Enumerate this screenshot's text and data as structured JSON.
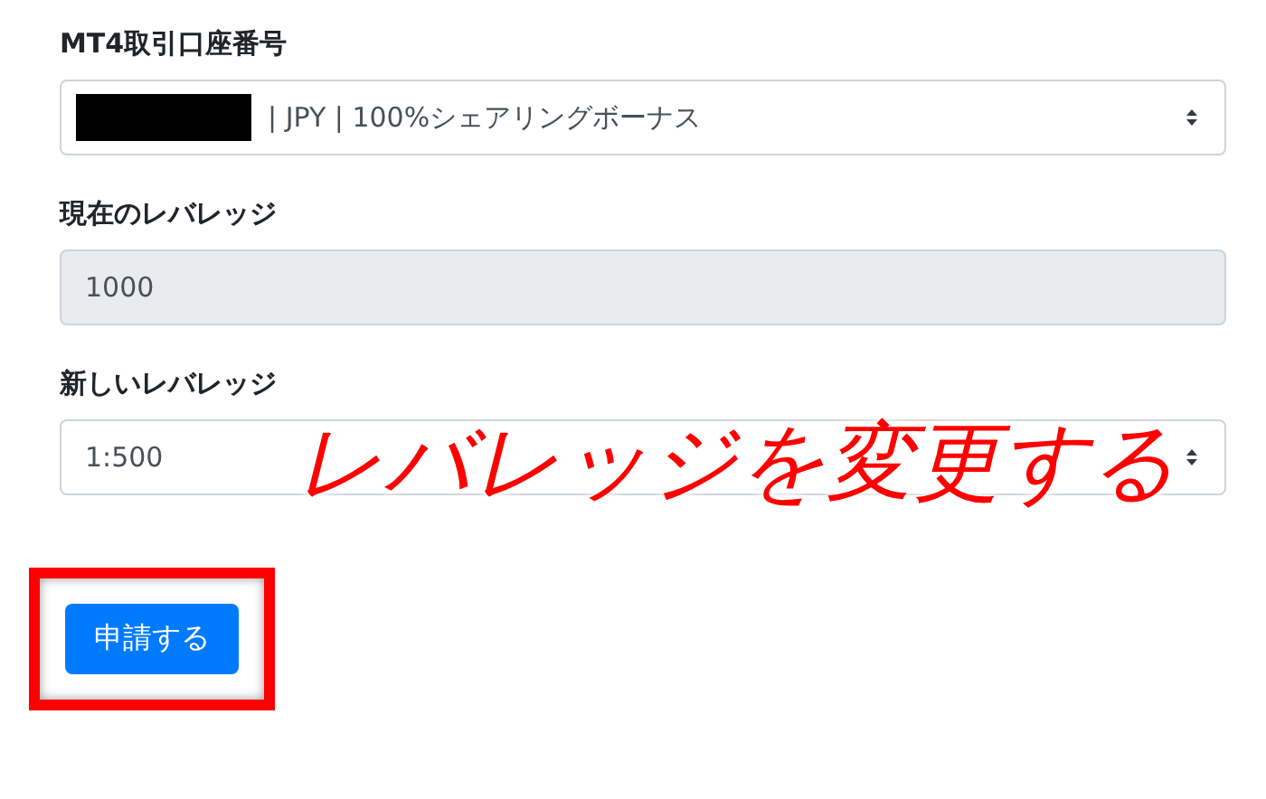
{
  "fields": [
    {
      "label": "MT4取引口座番号",
      "kind": "select",
      "value": "| JPY | 100%シェアリングボーナス",
      "redacted": true,
      "disabled": false
    },
    {
      "label": "現在のレバレッジ",
      "kind": "input",
      "value": "1000",
      "redacted": false,
      "disabled": true
    },
    {
      "label": "新しいレバレッジ",
      "kind": "select",
      "value": "1:500",
      "redacted": false,
      "disabled": false
    }
  ],
  "annotation": "レバレッジを変更する",
  "submit_button": {
    "label": "申請する",
    "highlighted": true
  }
}
